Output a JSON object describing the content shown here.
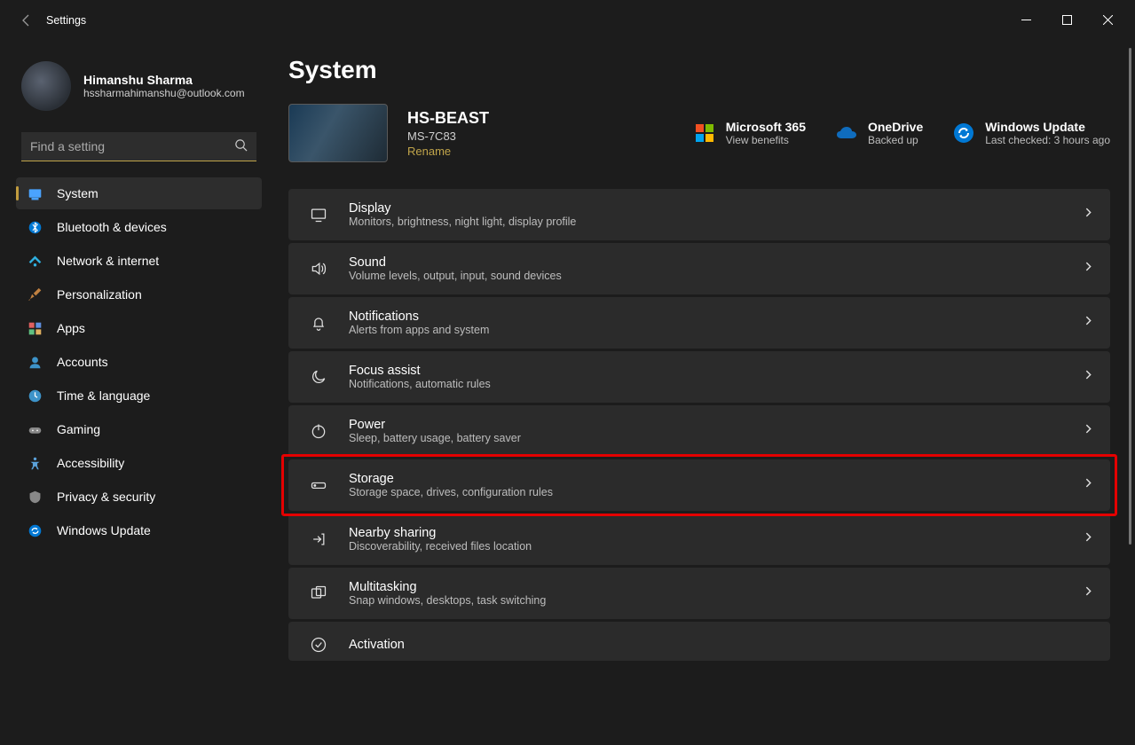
{
  "window": {
    "title": "Settings"
  },
  "user": {
    "name": "Himanshu Sharma",
    "email": "hssharmahimanshu@outlook.com"
  },
  "search": {
    "placeholder": "Find a setting"
  },
  "nav": [
    {
      "label": "System",
      "active": true
    },
    {
      "label": "Bluetooth & devices"
    },
    {
      "label": "Network & internet"
    },
    {
      "label": "Personalization"
    },
    {
      "label": "Apps"
    },
    {
      "label": "Accounts"
    },
    {
      "label": "Time & language"
    },
    {
      "label": "Gaming"
    },
    {
      "label": "Accessibility"
    },
    {
      "label": "Privacy & security"
    },
    {
      "label": "Windows Update"
    }
  ],
  "page": {
    "title": "System",
    "device": {
      "name": "HS-BEAST",
      "model": "MS-7C83",
      "rename": "Rename"
    },
    "links": {
      "ms365": {
        "title": "Microsoft 365",
        "sub": "View benefits"
      },
      "onedrive": {
        "title": "OneDrive",
        "sub": "Backed up"
      },
      "winupdate": {
        "title": "Windows Update",
        "sub": "Last checked: 3 hours ago"
      }
    },
    "items": [
      {
        "title": "Display",
        "sub": "Monitors, brightness, night light, display profile"
      },
      {
        "title": "Sound",
        "sub": "Volume levels, output, input, sound devices"
      },
      {
        "title": "Notifications",
        "sub": "Alerts from apps and system"
      },
      {
        "title": "Focus assist",
        "sub": "Notifications, automatic rules"
      },
      {
        "title": "Power",
        "sub": "Sleep, battery usage, battery saver"
      },
      {
        "title": "Storage",
        "sub": "Storage space, drives, configuration rules",
        "highlighted": true
      },
      {
        "title": "Nearby sharing",
        "sub": "Discoverability, received files location"
      },
      {
        "title": "Multitasking",
        "sub": "Snap windows, desktops, task switching"
      },
      {
        "title": "Activation",
        "sub": ""
      }
    ]
  }
}
